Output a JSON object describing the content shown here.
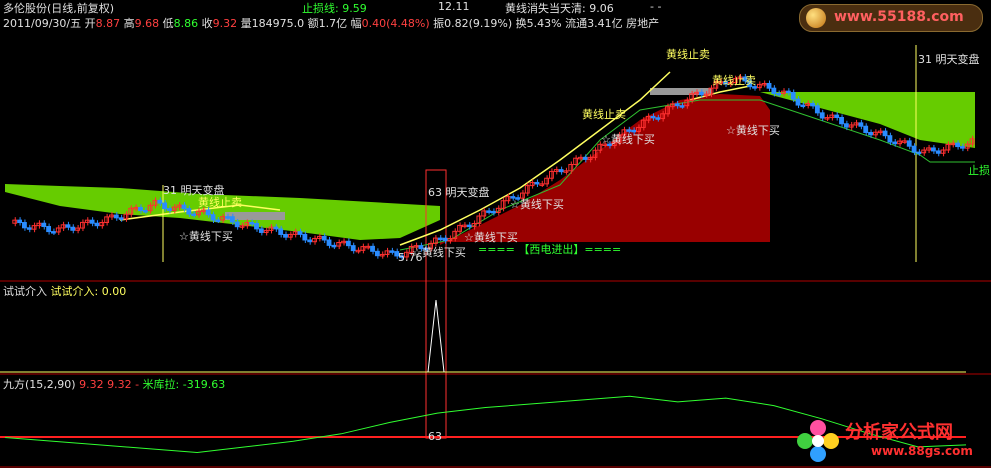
{
  "header": {
    "stock_name": "多伦股份(日线,前复权)",
    "date": "2011/09/30/五",
    "open_label": "开",
    "open": "8.87",
    "high_label": "高",
    "high": "9.68",
    "low_label": "低",
    "low": "8.86",
    "close_label": "收",
    "close": "9.32",
    "volume_label": "量",
    "volume": "184975.0",
    "amount_label": "额",
    "amount": "1.7亿",
    "change_label": "幅",
    "change": "0.40(4.48%)",
    "amplitude_label": "振",
    "amplitude": "0.82(9.19%)",
    "turnover_label": "换",
    "turnover": "5.43%",
    "float_label": "流通",
    "float": "3.41亿",
    "sector": "房地产",
    "stoploss_label": "止损线:",
    "stoploss": "9.59",
    "val2": "12.11",
    "yellowline_label": "黄线消失当天清:",
    "yellowline": "9.06",
    "dashes": "- -"
  },
  "main_annotations": {
    "sell_yellow_1": "黄线止卖",
    "sell_yellow_2": "黄线止卖",
    "sell_yellow_3": "黄线止卖",
    "sell_yellow_4": "黄线止卖",
    "buy_1": "☆黄线下买",
    "buy_2": "☆黄线下买",
    "buy_3": "☆黄线下买",
    "buy_4": "☆黄线下买",
    "buy_5": "☆黄线下买",
    "buy_6": "☆黄线下买",
    "change_1": "31 明天变盘",
    "change_2": "63 明天变盘",
    "change_3": "31 明天变盘",
    "xidian": "==== 【西电进出】====",
    "low_price": "5.76",
    "stoploss_tag": "止损"
  },
  "panel2": {
    "title": "试试介入",
    "label": "试试介入:",
    "value": "0.00"
  },
  "panel3": {
    "title": "九方(15,2,90)",
    "v1": "9.32",
    "v2": "9.32",
    "v3": "-",
    "milabel": "米库拉:",
    "mivalue": "-319.63",
    "bottom_tag": "63"
  },
  "watermarks": {
    "top_url": "www.55188.com",
    "bottom_cn": "分析家公式网",
    "bottom_url": "www.88gs.com"
  },
  "colors": {
    "up": "#ff3030",
    "down": "#30ffff",
    "yellow_line": "#ffff60",
    "green_fill": "#66cc00",
    "darkred_fill": "#990000",
    "grid": "#b00000"
  },
  "chart_data": [
    {
      "type": "line",
      "title": "多伦股份(日线,前复权)",
      "note": "Daily candlestick chart with yellow trend line; approx close series",
      "x": [
        1,
        10,
        20,
        30,
        40,
        50,
        60,
        70,
        80,
        90,
        100,
        110,
        120,
        130,
        140,
        150,
        160,
        170,
        180,
        190,
        200
      ],
      "series": [
        {
          "name": "close",
          "values": [
            6.8,
            6.6,
            6.9,
            7.4,
            7.1,
            6.7,
            6.4,
            6.1,
            5.8,
            6.3,
            7.2,
            8.1,
            8.9,
            9.8,
            10.6,
            11.3,
            10.9,
            10.1,
            9.6,
            9.0,
            9.32
          ]
        }
      ],
      "ylim": [
        5.5,
        12.5
      ]
    },
    {
      "type": "line",
      "title": "试试介入",
      "series": [
        {
          "name": "试试介入",
          "values": [
            0,
            0,
            0,
            0,
            0,
            0,
            0,
            0,
            0,
            0,
            1,
            0,
            0,
            0,
            0,
            0,
            0,
            0,
            0,
            0,
            0
          ]
        }
      ],
      "ylim": [
        0,
        1
      ]
    },
    {
      "type": "line",
      "title": "九方(15,2,90)",
      "series": [
        {
          "name": "米库拉",
          "values": [
            -280,
            -300,
            -320,
            -340,
            -360,
            -330,
            -300,
            -260,
            -200,
            -150,
            -120,
            -100,
            -80,
            -60,
            -90,
            -70,
            -110,
            -180,
            -260,
            -330,
            -319.63
          ]
        }
      ],
      "ylim": [
        -400,
        0
      ]
    }
  ]
}
